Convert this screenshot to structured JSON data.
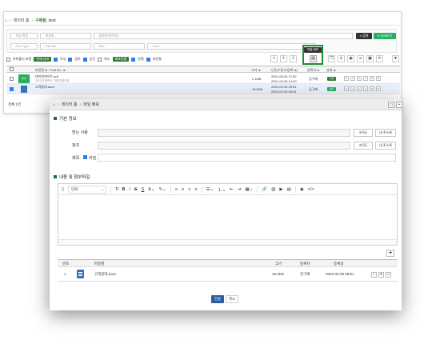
{
  "background": {
    "breadcrumb": [
      "데이터 홈",
      "구매팀_test"
    ],
    "search": {
      "field1": "- 파일 종류 -",
      "field2": "- 파일명 -",
      "field3": "- 설명(변경이력) -",
      "field4": "- Doc.Type -",
      "field5": "- Part No. -",
      "field6": "- Rev -",
      "field7": "- Desc -",
      "search_btn": "검색",
      "detail_btn": "상세보기"
    },
    "filters": {
      "subfolder": "하위폴더 포함",
      "tag1": "현재 상태",
      "chk1": "작성",
      "chk2": "검토",
      "chk3": "승인",
      "chk4": "취소",
      "tag2": "배포현황",
      "chk5": "완결",
      "chk6": "미완결"
    },
    "tooltip": "파일 배포",
    "columns": {
      "name": "파일명 ≑ / Part No. ≑",
      "size": "크기 ≑",
      "time": "시간(수정시/등록 ≑)",
      "user": "등록자 ≑",
      "state": "상태 ≑"
    },
    "rows": [
      {
        "name": "테이먼에이트.pdf",
        "sub": "2022년 협력사 기획 업데이트",
        "size": "2.1MB",
        "time1": "2021-08-26 17:52",
        "time2": "2021-09-30 14:40",
        "user": "김구매",
        "state": "작성",
        "state_color": "#2e7d32"
      },
      {
        "name": "고객중대.docx",
        "sub": "",
        "size": "15.0KB",
        "time1": "2022-02-09 09:51",
        "time2": "2022-02-09 09:51",
        "user": "김구매",
        "state": "승인",
        "state_color": "#27ae60"
      }
    ],
    "total": "전체 2건"
  },
  "modal": {
    "breadcrumb": [
      "데이터 홈",
      "파일 배포"
    ],
    "section_basic": "기본 정보",
    "labels": {
      "to": "받는 사람",
      "cc": "참조",
      "subject": "제목",
      "secret": "비밀"
    },
    "org_btn": "조직도",
    "my_addr_btn": "내 주소록",
    "section_content": "내용 및 첨부파일",
    "editor": {
      "paragraph": "단락"
    },
    "table": {
      "headers": [
        "번호",
        "파일명",
        "크기",
        "등록자",
        "등록일"
      ],
      "rows": [
        {
          "no": "1",
          "name": "고객중대.docx",
          "size": "15.0KB",
          "user": "김구매",
          "date": "2022-02-09 09:51"
        }
      ]
    },
    "send_btn": "전송",
    "cancel_btn": "취소"
  }
}
